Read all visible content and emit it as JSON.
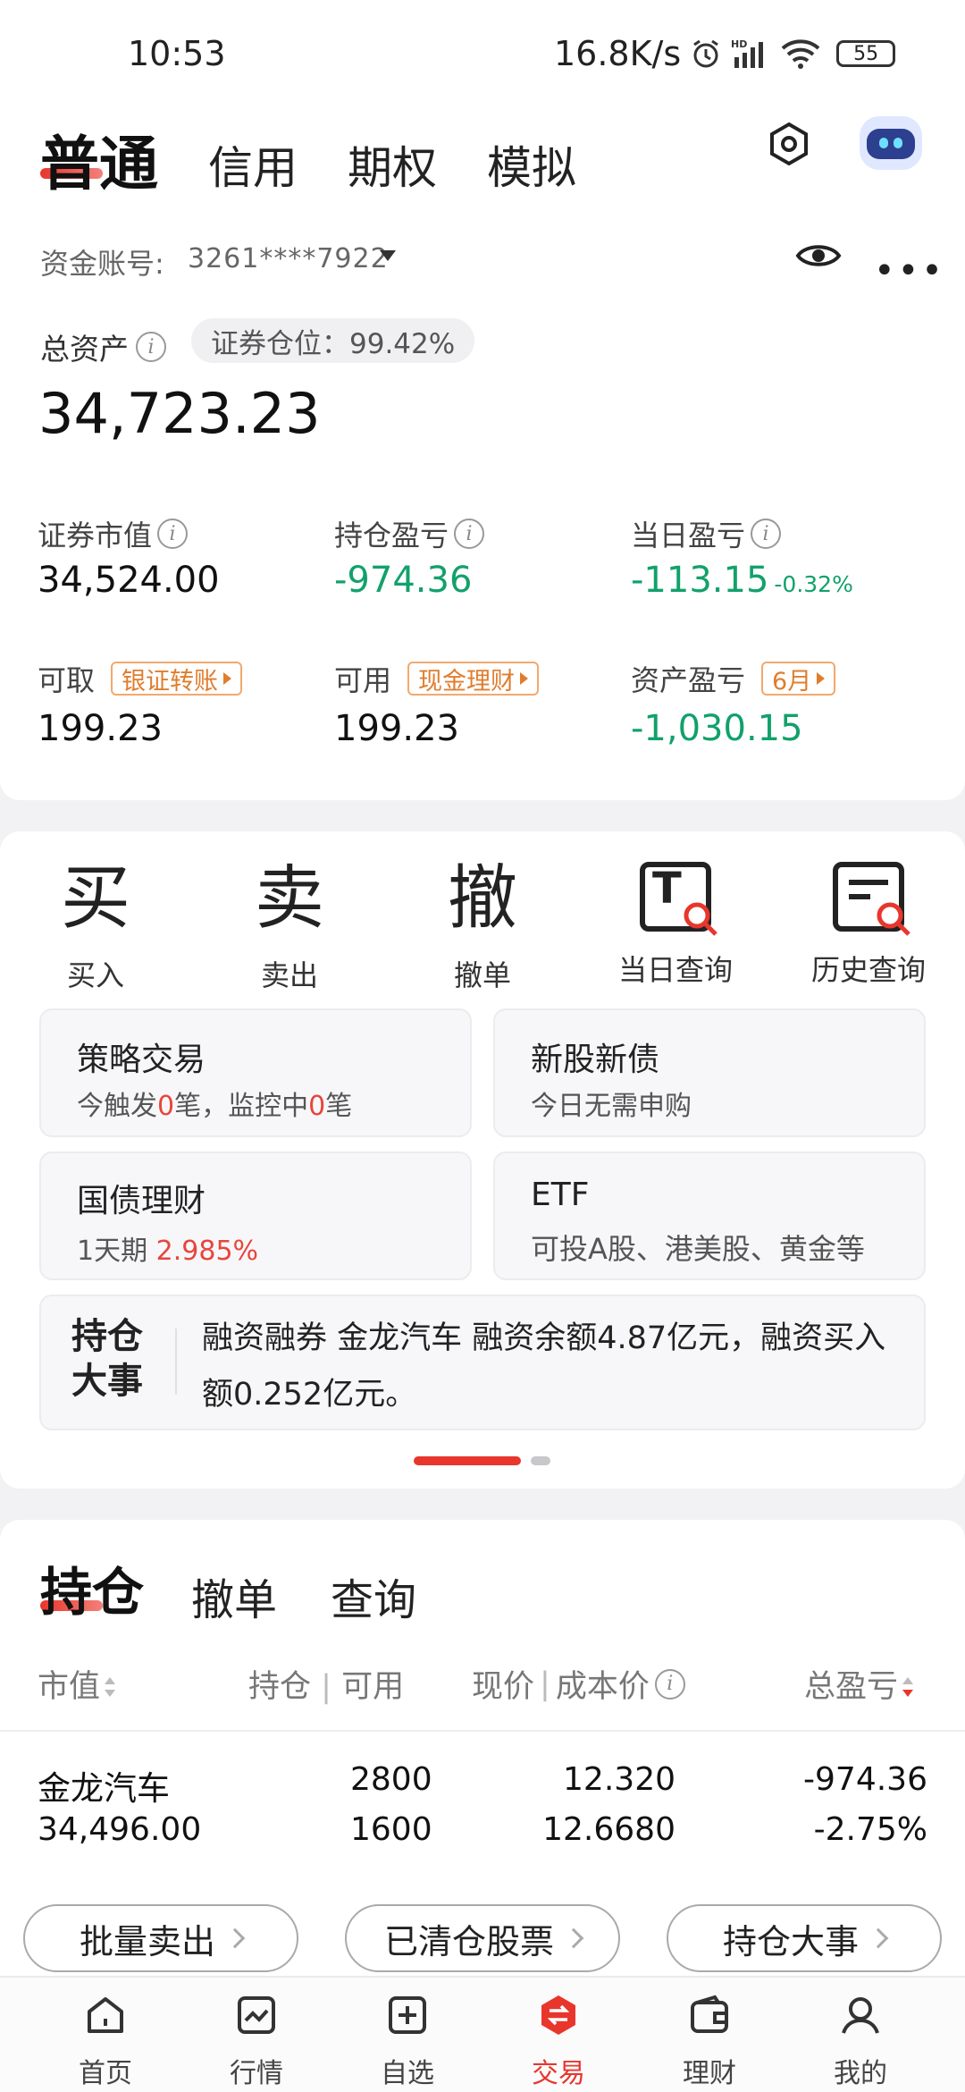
{
  "status_bar": {
    "time": "10:53",
    "network_speed": "16.8K/s",
    "battery": "55"
  },
  "top_tabs": {
    "active": "普通",
    "others": [
      "信用",
      "期权",
      "模拟"
    ]
  },
  "account": {
    "label": "资金账号:",
    "number": "3261****7922"
  },
  "assets": {
    "total_label": "总资产",
    "position_chip": "证券仓位：99.42%",
    "total_value": "34,723.23",
    "stats": [
      {
        "label": "证券市值",
        "value": "34,524.00"
      },
      {
        "label": "持仓盈亏",
        "value": "-974.36"
      },
      {
        "label": "当日盈亏",
        "value": "-113.15",
        "extra": "-0.32%"
      },
      {
        "label": "可取",
        "chip": "银证转账",
        "value": "199.23"
      },
      {
        "label": "可用",
        "chip": "现金理财",
        "value": "199.23"
      },
      {
        "label": "资产盈亏",
        "chip": "6月",
        "value": "-1,030.15"
      }
    ]
  },
  "functions": [
    {
      "glyph": "买",
      "label": "买入"
    },
    {
      "glyph": "卖",
      "label": "卖出"
    },
    {
      "glyph": "撤",
      "label": "撤单"
    },
    {
      "glyph": "T",
      "label": "当日查询"
    },
    {
      "glyph": "",
      "label": "历史查询"
    }
  ],
  "tiles": {
    "strategy": {
      "title": "策略交易",
      "sub_a": "今触发",
      "n1": "0",
      "sub_b": "笔，监控中",
      "n2": "0",
      "sub_c": "笔"
    },
    "ipo": {
      "title": "新股新债",
      "sub": "今日无需申购"
    },
    "bond": {
      "title": "国债理财",
      "sub": "1天期",
      "rate": "2.985%"
    },
    "etf": {
      "title": "ETF",
      "sub": "可投A股、港美股、黄金等"
    }
  },
  "news": {
    "badge_top": "持仓",
    "badge_bottom": "大事",
    "text": "融资融券 金龙汽车 融资余额4.87亿元，融资买入额0.252亿元。"
  },
  "holdings": {
    "tabs": [
      "持仓",
      "撤单",
      "查询"
    ],
    "columns": {
      "c1": "市值",
      "c2a": "持仓",
      "c2b": "可用",
      "c3a": "现价",
      "c3b": "成本价",
      "c4": "总盈亏"
    },
    "rows": [
      {
        "name": "金龙汽车",
        "market_value": "34,496.00",
        "position": "2800",
        "available": "1600",
        "price": "12.320",
        "cost": "12.6680",
        "pl": "-974.36",
        "pl_pct": "-2.75%"
      }
    ],
    "actions": [
      "批量卖出",
      "已清仓股票",
      "持仓大事"
    ]
  },
  "nav": [
    {
      "label": "首页",
      "icon": "home-icon"
    },
    {
      "label": "行情",
      "icon": "chart-icon"
    },
    {
      "label": "自选",
      "icon": "add-square-icon"
    },
    {
      "label": "交易",
      "icon": "trade-icon"
    },
    {
      "label": "理财",
      "icon": "wallet-icon"
    },
    {
      "label": "我的",
      "icon": "profile-icon"
    }
  ],
  "colors": {
    "accent_red": "#e8362d",
    "loss_green": "#12a16b",
    "chip_orange": "#e07d2d"
  }
}
